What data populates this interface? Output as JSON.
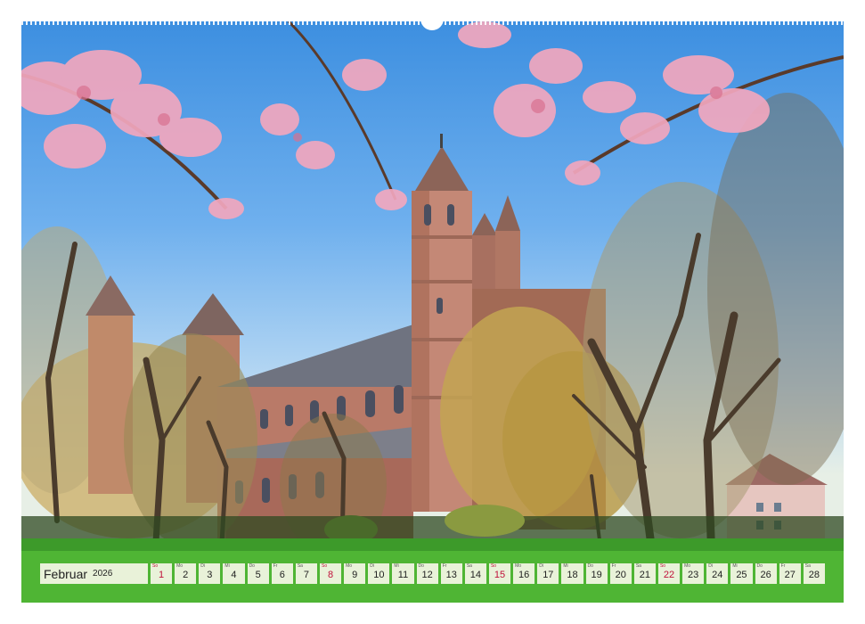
{
  "calendar": {
    "month": "Februar",
    "year": "2026",
    "days": [
      {
        "wd": "So",
        "d": "1",
        "red": true
      },
      {
        "wd": "Mo",
        "d": "2"
      },
      {
        "wd": "Di",
        "d": "3"
      },
      {
        "wd": "Mi",
        "d": "4"
      },
      {
        "wd": "Do",
        "d": "5"
      },
      {
        "wd": "Fr",
        "d": "6"
      },
      {
        "wd": "Sa",
        "d": "7"
      },
      {
        "wd": "So",
        "d": "8",
        "red": true
      },
      {
        "wd": "Mo",
        "d": "9"
      },
      {
        "wd": "Di",
        "d": "10"
      },
      {
        "wd": "Mi",
        "d": "11"
      },
      {
        "wd": "Do",
        "d": "12"
      },
      {
        "wd": "Fr",
        "d": "13"
      },
      {
        "wd": "Sa",
        "d": "14"
      },
      {
        "wd": "So",
        "d": "15",
        "red": true
      },
      {
        "wd": "Mo",
        "d": "16"
      },
      {
        "wd": "Di",
        "d": "17"
      },
      {
        "wd": "Mi",
        "d": "18"
      },
      {
        "wd": "Do",
        "d": "19"
      },
      {
        "wd": "Fr",
        "d": "20"
      },
      {
        "wd": "Sa",
        "d": "21"
      },
      {
        "wd": "So",
        "d": "22",
        "red": true
      },
      {
        "wd": "Mo",
        "d": "23"
      },
      {
        "wd": "Di",
        "d": "24"
      },
      {
        "wd": "Mi",
        "d": "25"
      },
      {
        "wd": "Do",
        "d": "26"
      },
      {
        "wd": "Fr",
        "d": "27"
      },
      {
        "wd": "Sa",
        "d": "28"
      }
    ]
  },
  "colors": {
    "sunday": "#c0103a",
    "sky": "#3d8fe0",
    "stone": "#b97a68",
    "grass": "#4fb534",
    "blossom": "#f2a7be"
  }
}
